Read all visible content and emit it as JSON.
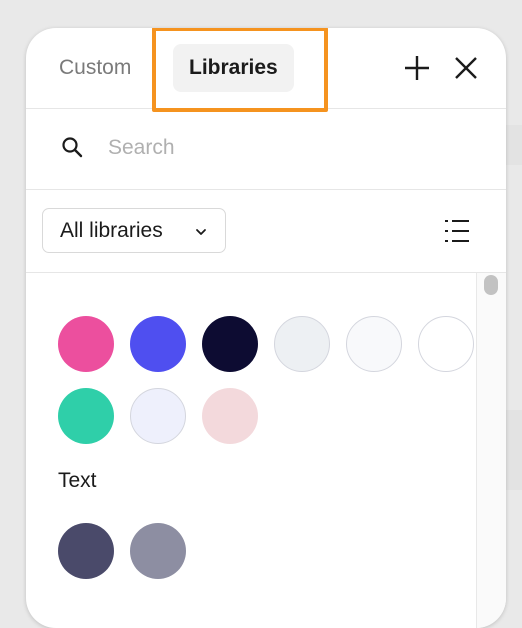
{
  "tabs": {
    "custom": "Custom",
    "libraries": "Libraries"
  },
  "header": {
    "add_icon": "plus-icon",
    "close_icon": "close-icon"
  },
  "search": {
    "placeholder": "Search",
    "value": "",
    "icon": "search-icon"
  },
  "filter": {
    "dropdown_label": "All libraries",
    "chevron_icon": "chevron-down-icon",
    "view_icon": "list-view-icon"
  },
  "sections": [
    {
      "title": "",
      "swatches": [
        {
          "color": "#ec4f9e"
        },
        {
          "color": "#4f4ff0"
        },
        {
          "color": "#0d0c32"
        },
        {
          "color": "#edf0f3"
        },
        {
          "color": "#f8f9fb"
        },
        {
          "color": "#ffffff"
        },
        {
          "color": "#2fcfa9"
        },
        {
          "color": "#eef0fc"
        },
        {
          "color": "#f3d9dc"
        }
      ]
    },
    {
      "title": "Text",
      "swatches": [
        {
          "color": "#4a4a6a"
        },
        {
          "color": "#8d8ea2"
        }
      ]
    }
  ]
}
